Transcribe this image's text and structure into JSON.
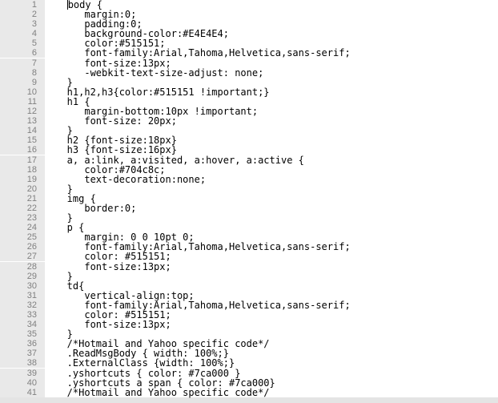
{
  "lines": [
    {
      "n": 1,
      "indent": 3,
      "text": "body {",
      "cursorBefore": true
    },
    {
      "n": 2,
      "indent": 6,
      "text": "margin:0;"
    },
    {
      "n": 3,
      "indent": 6,
      "text": "padding:0;"
    },
    {
      "n": 4,
      "indent": 6,
      "text": "background-color:#E4E4E4;"
    },
    {
      "n": 5,
      "indent": 6,
      "text": "color:#515151;"
    },
    {
      "n": 6,
      "indent": 6,
      "text": "font-family:Arial,Tahoma,Helvetica,sans-serif;"
    },
    {
      "n": 7,
      "indent": 6,
      "text": "font-size:13px;"
    },
    {
      "n": 8,
      "indent": 6,
      "text": "-webkit-text-size-adjust: none;"
    },
    {
      "n": 9,
      "indent": 3,
      "text": "}"
    },
    {
      "n": 10,
      "indent": 3,
      "text": "h1,h2,h3{color:#515151 !important;}"
    },
    {
      "n": 11,
      "indent": 3,
      "text": "h1 {"
    },
    {
      "n": 12,
      "indent": 6,
      "text": "margin-bottom:10px !important;"
    },
    {
      "n": 13,
      "indent": 6,
      "text": "font-size: 20px;"
    },
    {
      "n": 14,
      "indent": 3,
      "text": "}"
    },
    {
      "n": 15,
      "indent": 3,
      "text": "h2 {font-size:18px}"
    },
    {
      "n": 16,
      "indent": 3,
      "text": "h3 {font-size:16px}"
    },
    {
      "n": 17,
      "indent": 3,
      "text": "a, a:link, a:visited, a:hover, a:active {"
    },
    {
      "n": 18,
      "indent": 6,
      "text": "color:#704c8c;"
    },
    {
      "n": 19,
      "indent": 6,
      "text": "text-decoration:none;"
    },
    {
      "n": 20,
      "indent": 3,
      "text": "}"
    },
    {
      "n": 21,
      "indent": 3,
      "text": "img {"
    },
    {
      "n": 22,
      "indent": 6,
      "text": "border:0;"
    },
    {
      "n": 23,
      "indent": 3,
      "text": "}"
    },
    {
      "n": 24,
      "indent": 3,
      "text": "p {"
    },
    {
      "n": 25,
      "indent": 6,
      "text": "margin: 0 0 10pt 0;"
    },
    {
      "n": 26,
      "indent": 6,
      "text": "font-family:Arial,Tahoma,Helvetica,sans-serif;"
    },
    {
      "n": 27,
      "indent": 6,
      "text": "color: #515151;"
    },
    {
      "n": 28,
      "indent": 6,
      "text": "font-size:13px;"
    },
    {
      "n": 29,
      "indent": 3,
      "text": "}"
    },
    {
      "n": 30,
      "indent": 3,
      "text": "td{"
    },
    {
      "n": 31,
      "indent": 6,
      "text": "vertical-align:top;"
    },
    {
      "n": 32,
      "indent": 6,
      "text": "font-family:Arial,Tahoma,Helvetica,sans-serif;"
    },
    {
      "n": 33,
      "indent": 6,
      "text": "color: #515151;"
    },
    {
      "n": 34,
      "indent": 6,
      "text": "font-size:13px;"
    },
    {
      "n": 35,
      "indent": 3,
      "text": "}"
    },
    {
      "n": 36,
      "indent": 3,
      "text": "/*Hotmail and Yahoo specific code*/"
    },
    {
      "n": 37,
      "indent": 3,
      "text": ".ReadMsgBody { width: 100%;}"
    },
    {
      "n": 38,
      "indent": 3,
      "text": ".ExternalClass {width: 100%;}"
    },
    {
      "n": 39,
      "indent": 3,
      "text": ".yshortcuts { color: #7ca000 }"
    },
    {
      "n": 40,
      "indent": 3,
      "text": ".yshortcuts a span { color: #7ca000}"
    },
    {
      "n": 41,
      "indent": 3,
      "text": "/*Hotmail and Yahoo specific code*/"
    }
  ]
}
